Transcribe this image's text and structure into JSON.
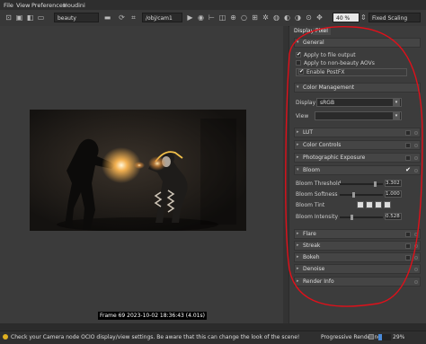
{
  "menu": [
    "File",
    "View",
    "Preferences",
    "Houdini"
  ],
  "toolbar": {
    "aov": "beauty",
    "camera_path": "/obj/cam1",
    "zoom": "40 %",
    "scaling": "Fixed Scaling",
    "rt_label": "RT"
  },
  "frame_info": "Frame 69  2023-10-02 18:36:43  (4.01s)",
  "panel": {
    "tabs": [
      "Display",
      "Pixel"
    ],
    "general": {
      "title": "General",
      "apply_file_output": "Apply to file output",
      "apply_non_beauty": "Apply to non-beauty AOVs",
      "enable_postfx": "Enable PostFX"
    },
    "color_management": {
      "title": "Color Management",
      "display_label": "Display",
      "display_value": "sRGB",
      "view_label": "View"
    },
    "lut": "LUT",
    "color_controls": "Color Controls",
    "photographic_exposure": "Photographic Exposure",
    "bloom": {
      "title": "Bloom",
      "threshold_label": "Bloom Threshold",
      "threshold_value": "3.302",
      "threshold_fraction": 0.85,
      "softness_label": "Bloom Softness",
      "softness_value": "1.000",
      "softness_fraction": 0.3,
      "tint_label": "Bloom Tint",
      "intensity_label": "Bloom Intensity",
      "intensity_value": "0.528",
      "intensity_fraction": 0.27
    },
    "flare": "Flare",
    "streak": "Streak",
    "bokeh": "Bokeh",
    "denoise": "Denoise",
    "render_info": "Render Info"
  },
  "status": {
    "message": "Check your Camera node OCIO display/view settings. Be aware that this can change the look of the scene!",
    "progress_label": "Progressive Rendering...",
    "progress_percent": "29%",
    "progress_fraction": 0.29
  },
  "annotation_color": "#e0101a"
}
